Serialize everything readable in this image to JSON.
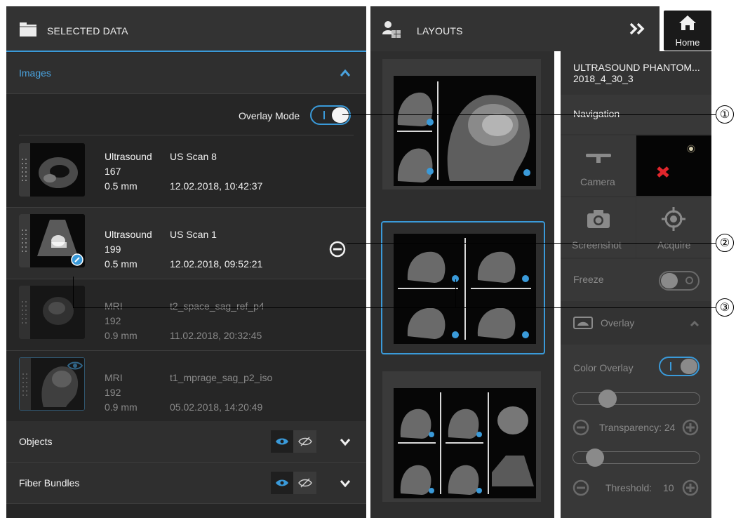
{
  "left_panel": {
    "title": "SELECTED DATA",
    "images_section": "Images",
    "overlay_mode_label": "Overlay Mode",
    "rows": [
      {
        "modality": "Ultrasound",
        "count": "167",
        "thickness": "0.5 mm",
        "name": "US Scan 8",
        "date": "12.02.2018, 10:42:37",
        "dimmed": false
      },
      {
        "modality": "Ultrasound",
        "count": "199",
        "thickness": "0.5 mm",
        "name": "US Scan 1",
        "date": "12.02.2018, 09:52:21",
        "dimmed": false
      },
      {
        "modality": "MRI",
        "count": "192",
        "thickness": "0.9 mm",
        "name": "t2_space_sag_ref_p4",
        "date": "11.02.2018, 20:32:45",
        "dimmed": true
      },
      {
        "modality": "MRI",
        "count": "192",
        "thickness": "0.9 mm",
        "name": "t1_mprage_sag_p2_iso",
        "date": "05.02.2018, 14:20:49",
        "dimmed": true
      }
    ],
    "objects_label": "Objects",
    "fiber_bundles_label": "Fiber Bundles"
  },
  "center_panel": {
    "title": "LAYOUTS"
  },
  "home": {
    "label": "Home"
  },
  "right_panel": {
    "patient_line1": "ULTRASOUND PHANTOM...",
    "patient_line2": "2018_4_30_3",
    "navigation_label": "Navigation",
    "camera_label": "Camera",
    "screenshot_label": "Screenshot",
    "acquire_label": "Acquire",
    "freeze_label": "Freeze",
    "overlay_label": "Overlay",
    "color_overlay_label": "Color Overlay",
    "transparency_label": "Transparency: 24",
    "threshold_label": "Threshold:",
    "threshold_value": "10"
  },
  "callouts": [
    "①",
    "②",
    "③"
  ],
  "colors": {
    "accent": "#3a9ad9",
    "panel": "#262626",
    "header": "#333333",
    "tracking_red": "#e0262c"
  }
}
